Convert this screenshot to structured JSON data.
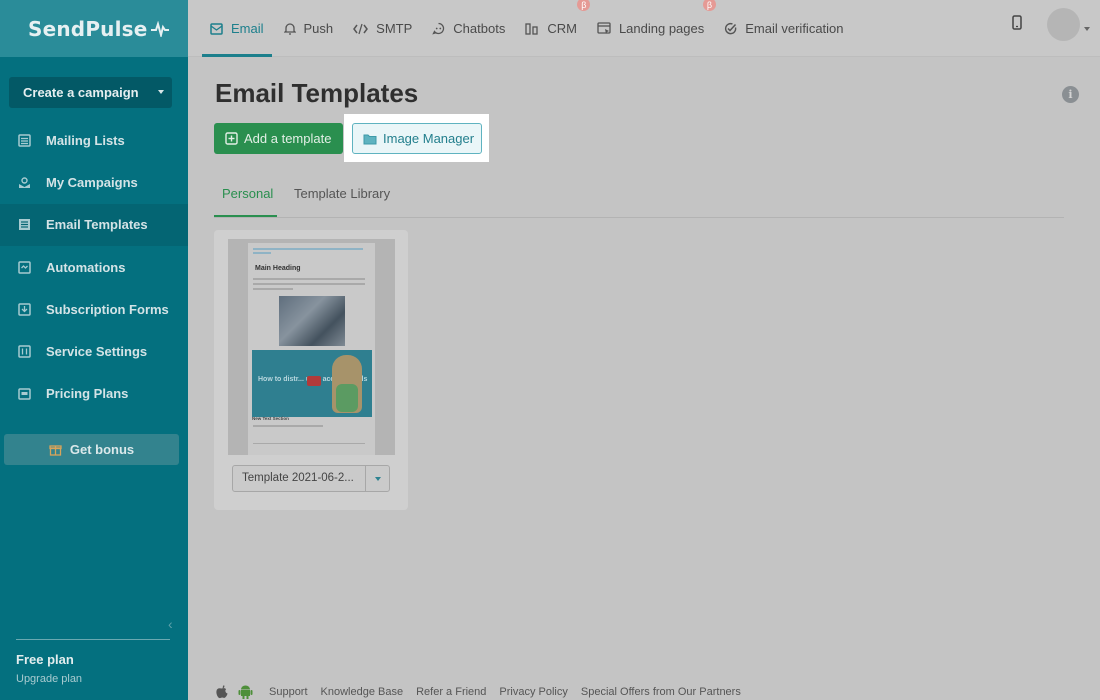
{
  "sidebar": {
    "logo": "SendPulse",
    "create_campaign": "Create a campaign",
    "items": [
      {
        "label": "Mailing Lists",
        "icon": "list-icon"
      },
      {
        "label": "My Campaigns",
        "icon": "campaign-icon"
      },
      {
        "label": "Email Templates",
        "icon": "template-icon",
        "active": true
      },
      {
        "label": "Automations",
        "icon": "automation-icon"
      },
      {
        "label": "Subscription Forms",
        "icon": "form-icon"
      },
      {
        "label": "Service Settings",
        "icon": "settings-icon"
      },
      {
        "label": "Pricing Plans",
        "icon": "pricing-icon"
      }
    ],
    "bonus": "Get bonus",
    "plan": "Free plan",
    "upgrade": "Upgrade plan"
  },
  "topnav": {
    "items": [
      {
        "label": "Email",
        "icon": "email-icon",
        "active": true
      },
      {
        "label": "Push",
        "icon": "bell-icon"
      },
      {
        "label": "SMTP",
        "icon": "code-icon"
      },
      {
        "label": "Chatbots",
        "icon": "chatbot-icon"
      },
      {
        "label": "CRM",
        "icon": "crm-icon",
        "beta": "β"
      },
      {
        "label": "Landing pages",
        "icon": "landing-icon",
        "beta": "β"
      },
      {
        "label": "Email verification",
        "icon": "check-circle-icon"
      }
    ]
  },
  "main": {
    "title": "Email Templates",
    "add_template": "Add a template",
    "image_manager": "Image Manager",
    "tabs": [
      "Personal",
      "Template Library"
    ],
    "template": {
      "name": "Template 2021-06-2...",
      "preview_heading": "Main Heading",
      "preview_video_text": "How to distr... user access levels",
      "preview_section": "New Text Section"
    }
  },
  "footer": {
    "links": [
      "Support",
      "Knowledge Base",
      "Refer a Friend",
      "Privacy Policy",
      "Special Offers from Our Partners"
    ]
  },
  "colors": {
    "sidebar_bg": "#04707f",
    "accent": "#1c7f8c",
    "green": "#2a8f4f",
    "beta": "#e59a95"
  }
}
